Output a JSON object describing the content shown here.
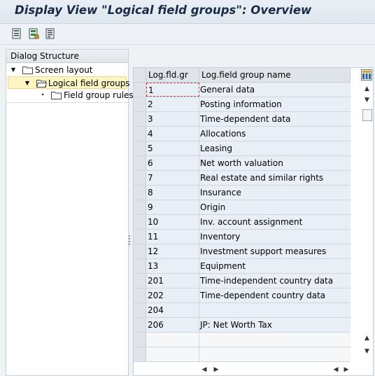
{
  "window": {
    "title": "Display View \"Logical field groups\": Overview"
  },
  "toolbar": {
    "buttons": [
      {
        "icon": "print-list-icon"
      },
      {
        "icon": "select-all-icon"
      },
      {
        "icon": "details-icon"
      }
    ]
  },
  "dialog_structure": {
    "header": "Dialog Structure",
    "nodes": [
      {
        "label": "Screen layout",
        "expander": "▼",
        "icon": "folder-icon"
      },
      {
        "label": "Logical field groups",
        "expander": "▼",
        "icon": "folder-open-icon",
        "selected": true
      },
      {
        "label": "Field group rules",
        "expander": "•",
        "icon": "folder-icon"
      }
    ]
  },
  "table": {
    "columns": [
      "Log.fld.gr",
      "Log.field group name"
    ],
    "rows": [
      {
        "id": "1",
        "name": "General data"
      },
      {
        "id": "2",
        "name": "Posting information"
      },
      {
        "id": "3",
        "name": "Time-dependent data"
      },
      {
        "id": "4",
        "name": "Allocations"
      },
      {
        "id": "5",
        "name": "Leasing"
      },
      {
        "id": "6",
        "name": "Net worth valuation"
      },
      {
        "id": "7",
        "name": "Real estate and similar rights"
      },
      {
        "id": "8",
        "name": "Insurance"
      },
      {
        "id": "9",
        "name": "Origin"
      },
      {
        "id": "10",
        "name": "Inv. account assignment"
      },
      {
        "id": "11",
        "name": "Inventory"
      },
      {
        "id": "12",
        "name": "Investment support measures"
      },
      {
        "id": "13",
        "name": "Equipment"
      },
      {
        "id": "201",
        "name": "Time-independent country data"
      },
      {
        "id": "202",
        "name": "Time-dependent country data"
      },
      {
        "id": "204",
        "name": ""
      },
      {
        "id": "206",
        "name": "JP: Net Worth Tax"
      },
      {
        "id": "",
        "name": ""
      },
      {
        "id": "",
        "name": ""
      }
    ]
  },
  "colors": {
    "accent": "#1a2b45",
    "header_bg": "#dfe4ea",
    "row_bg": "#e9eff6",
    "selected_node": "#fdf6c3"
  }
}
